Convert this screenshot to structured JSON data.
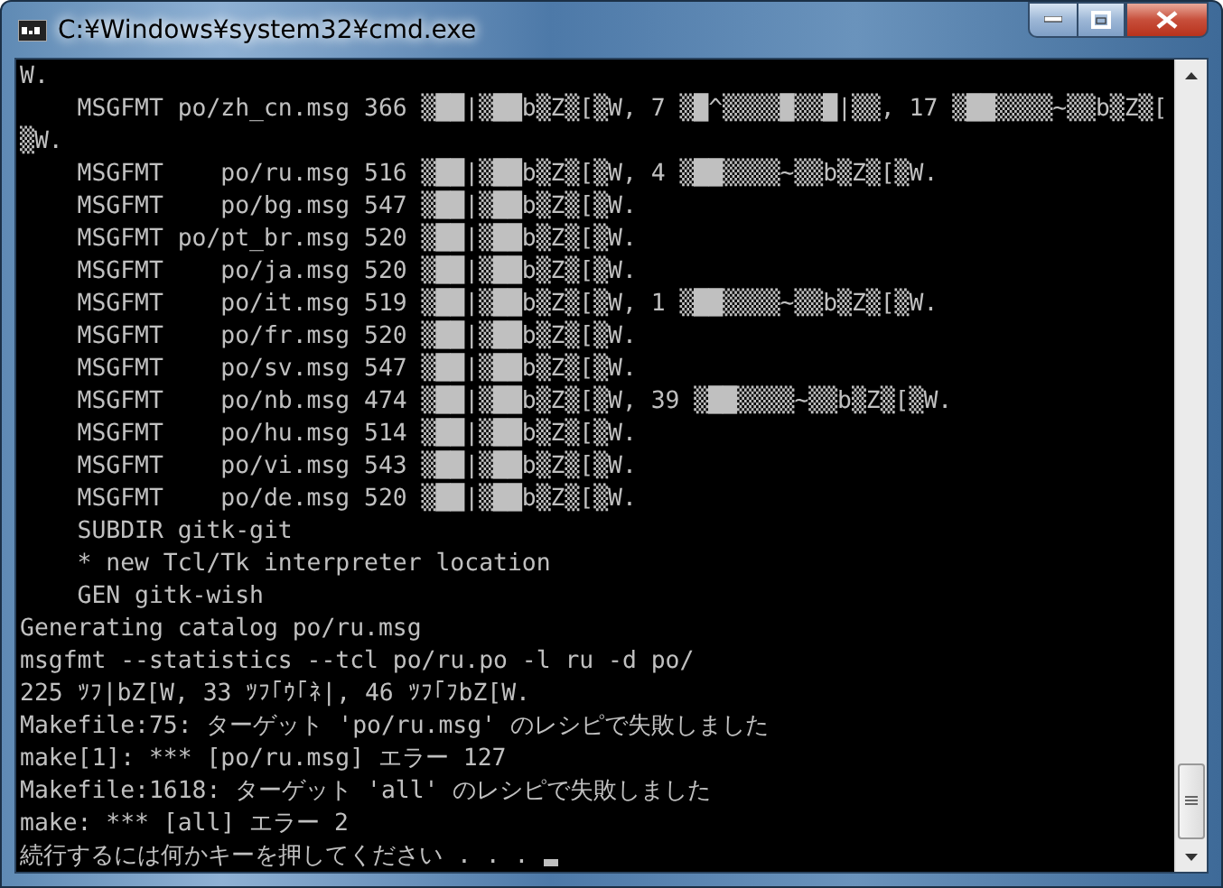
{
  "window": {
    "title": "C:¥Windows¥system32¥cmd.exe"
  },
  "console": {
    "lines": [
      "W.",
      "    MSGFMT po/zh_cn.msg 366 ▒██|▒██b▒Z▒[▒W, 7 ▒█^▒▒▒▒█▒▒█|▒▒, 17 ▒██▒▒▒▒~▒▒b▒Z▒[",
      "▒W.",
      "    MSGFMT    po/ru.msg 516 ▒██|▒██b▒Z▒[▒W, 4 ▒██▒▒▒▒~▒▒b▒Z▒[▒W.",
      "    MSGFMT    po/bg.msg 547 ▒██|▒██b▒Z▒[▒W.",
      "    MSGFMT po/pt_br.msg 520 ▒██|▒██b▒Z▒[▒W.",
      "    MSGFMT    po/ja.msg 520 ▒██|▒██b▒Z▒[▒W.",
      "    MSGFMT    po/it.msg 519 ▒██|▒██b▒Z▒[▒W, 1 ▒██▒▒▒▒~▒▒b▒Z▒[▒W.",
      "    MSGFMT    po/fr.msg 520 ▒██|▒██b▒Z▒[▒W.",
      "    MSGFMT    po/sv.msg 547 ▒██|▒██b▒Z▒[▒W.",
      "    MSGFMT    po/nb.msg 474 ▒██|▒██b▒Z▒[▒W, 39 ▒██▒▒▒▒~▒▒b▒Z▒[▒W.",
      "    MSGFMT    po/hu.msg 514 ▒██|▒██b▒Z▒[▒W.",
      "    MSGFMT    po/vi.msg 543 ▒██|▒██b▒Z▒[▒W.",
      "    MSGFMT    po/de.msg 520 ▒██|▒██b▒Z▒[▒W.",
      "    SUBDIR gitk-git",
      "    * new Tcl/Tk interpreter location",
      "    GEN gitk-wish",
      "Generating catalog po/ru.msg",
      "msgfmt --statistics --tcl po/ru.po -l ru -d po/",
      "225 ﾂﾌ|bZ[W, 33 ﾂﾌ｢ｳ｢ﾈ|, 46 ﾂﾌ｢ﾌbZ[W.",
      "Makefile:75: ターゲット 'po/ru.msg' のレシピで失敗しました",
      "make[1]: *** [po/ru.msg] エラー 127",
      "Makefile:1618: ターゲット 'all' のレシピで失敗しました",
      "make: *** [all] エラー 2",
      "続行するには何かキーを押してください . . . "
    ],
    "cursor": true
  }
}
